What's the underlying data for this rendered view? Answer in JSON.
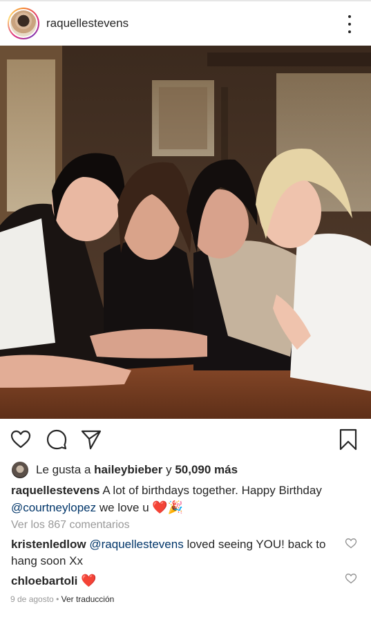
{
  "post": {
    "username": "raquellestevens",
    "likes": {
      "prefix": "Le gusta a",
      "liker": "haileybieber",
      "connector": "y",
      "count_text": "50,090 más"
    },
    "caption": {
      "username": "raquellestevens",
      "text_part1": "A lot of birthdays together. Happy Birthday",
      "mention": "@courtneylopez",
      "text_part2": "we love u",
      "emojis": "❤️🎉"
    },
    "view_all_comments": "Ver los 867 comentarios",
    "comments": [
      {
        "username": "kristenledlow",
        "mention": "@raquellestevens",
        "text": "loved seeing YOU! back to hang soon Xx"
      },
      {
        "username": "chloebartoli",
        "text": "❤️"
      }
    ],
    "date": "9 de agosto",
    "separator": "•",
    "translate_label": "Ver traducción"
  },
  "icons": {
    "like": "heart-outline-icon",
    "comment": "comment-bubble-icon",
    "share": "paper-plane-icon",
    "save": "bookmark-icon",
    "more": "vertical-dots-icon"
  },
  "colors": {
    "text": "#262626",
    "muted": "#999999",
    "mention": "#003569",
    "heart": "#e0245e"
  }
}
